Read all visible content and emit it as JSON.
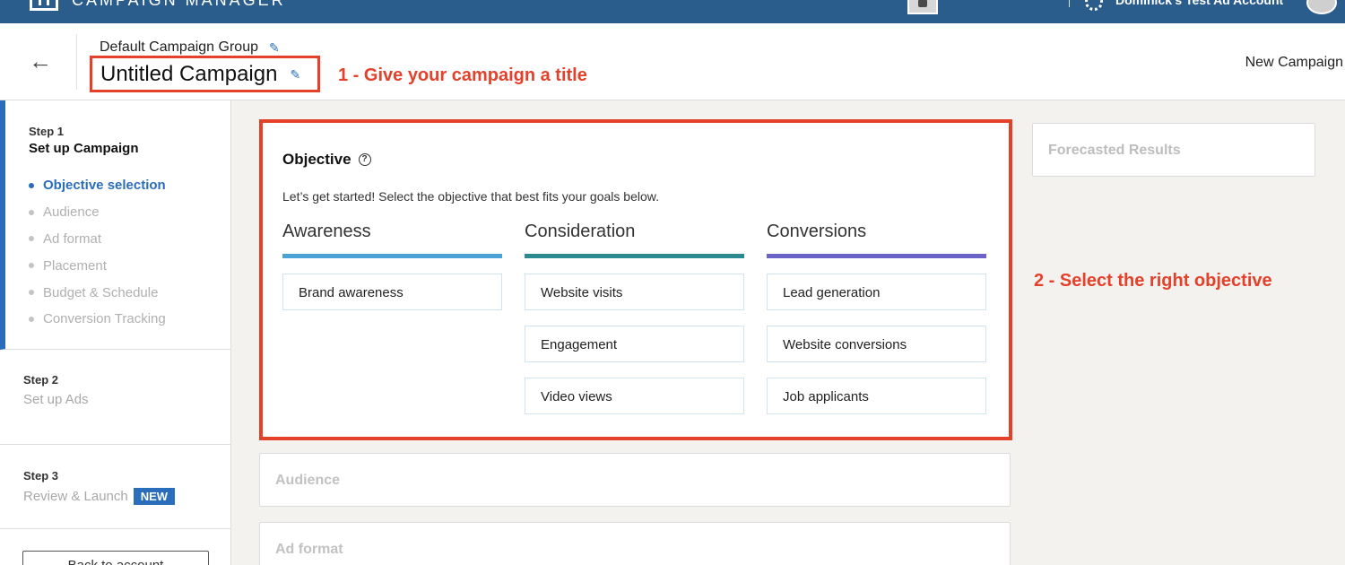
{
  "topbar": {
    "app_title": "CAMPAIGN MANAGER",
    "account_name": "Dominick's Test Ad Account"
  },
  "header": {
    "group_name": "Default Campaign Group",
    "campaign_title": "Untitled Campaign",
    "right_label": "New Campaign"
  },
  "annotations": {
    "title_hint": "1 - Give your campaign a title",
    "objective_hint": "2 - Select the right objective"
  },
  "sidebar": {
    "step1": {
      "number": "Step 1",
      "title": "Set up Campaign",
      "items": [
        {
          "label": "Objective selection",
          "active": true
        },
        {
          "label": "Audience",
          "active": false
        },
        {
          "label": "Ad format",
          "active": false
        },
        {
          "label": "Placement",
          "active": false
        },
        {
          "label": "Budget & Schedule",
          "active": false
        },
        {
          "label": "Conversion Tracking",
          "active": false
        }
      ]
    },
    "step2": {
      "number": "Step 2",
      "title": "Set up Ads"
    },
    "step3": {
      "number": "Step 3",
      "title": "Review & Launch",
      "badge": "NEW"
    },
    "back_button": "Back to account"
  },
  "objective": {
    "title": "Objective",
    "description": "Let’s get started! Select the objective that best fits your goals below.",
    "columns": [
      {
        "title": "Awareness",
        "color": "#4aa3d6",
        "options": [
          "Brand awareness"
        ]
      },
      {
        "title": "Consideration",
        "color": "#2b8a8f",
        "options": [
          "Website visits",
          "Engagement",
          "Video views"
        ]
      },
      {
        "title": "Conversions",
        "color": "#6c63c9",
        "options": [
          "Lead generation",
          "Website conversions",
          "Job applicants"
        ]
      }
    ]
  },
  "sections": {
    "audience": "Audience",
    "ad_format": "Ad format",
    "forecast": "Forecasted Results"
  },
  "colors": {
    "brand_blue": "#2b5d8c",
    "accent": "#2a6ebb",
    "annotation_red": "#e5402a"
  }
}
